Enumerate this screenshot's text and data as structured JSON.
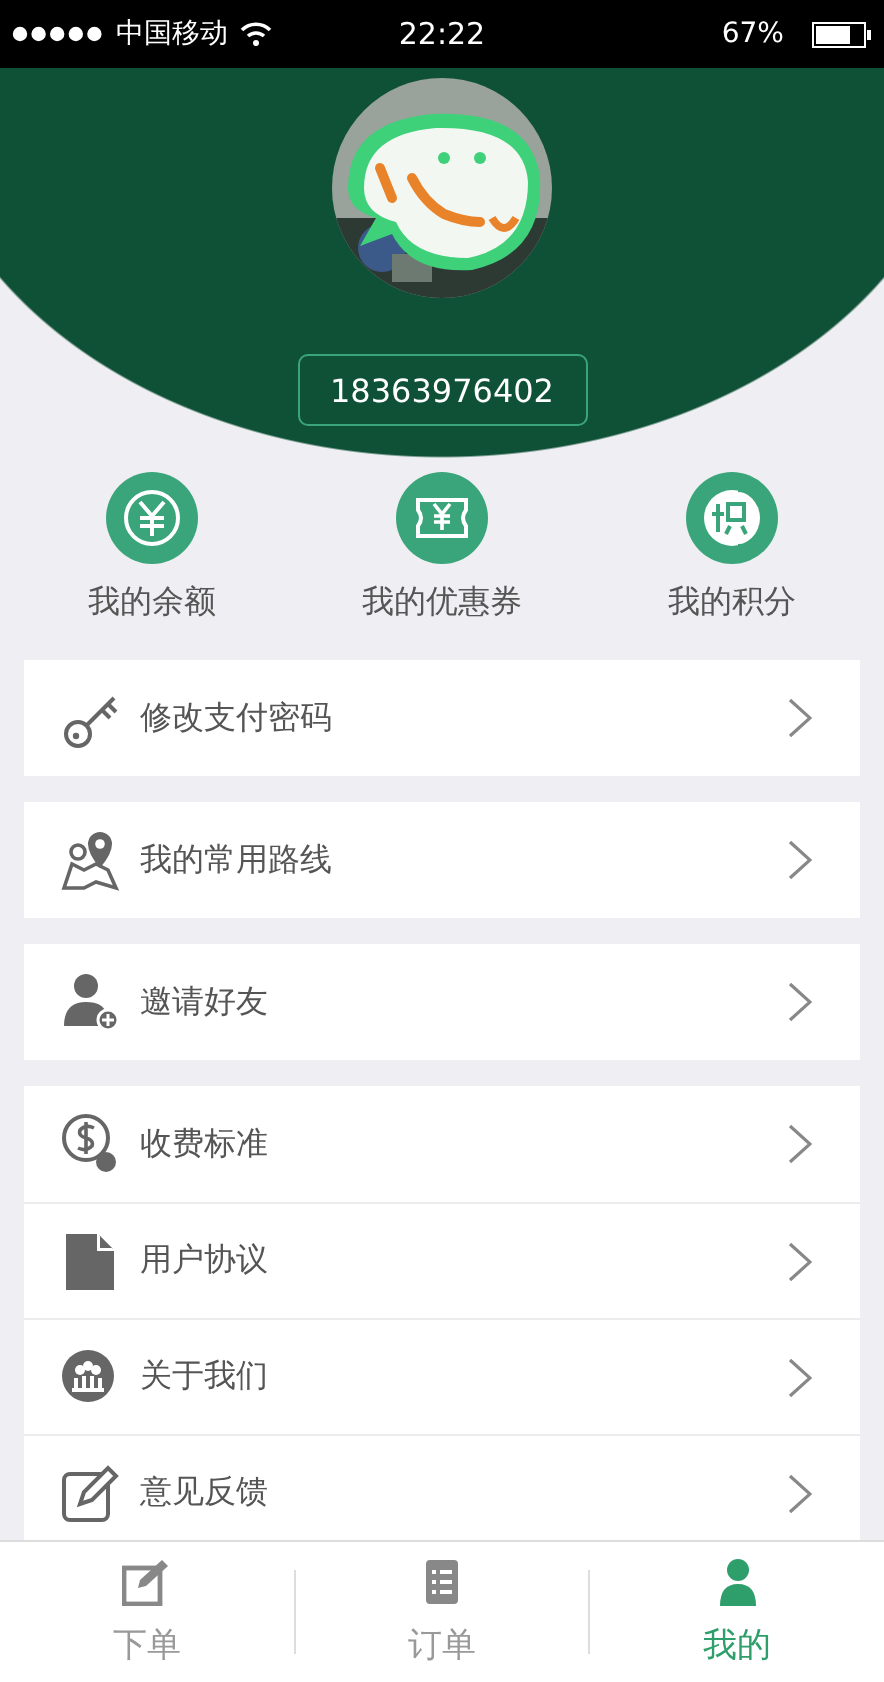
{
  "status_bar": {
    "carrier": "中国移动",
    "time": "22:22",
    "battery": "67%"
  },
  "profile": {
    "phone": "18363976402"
  },
  "quick_links": [
    {
      "label": "我的余额"
    },
    {
      "label": "我的优惠券"
    },
    {
      "label": "我的积分"
    }
  ],
  "menu_groups": [
    [
      {
        "label": "修改支付密码"
      }
    ],
    [
      {
        "label": "我的常用路线"
      }
    ],
    [
      {
        "label": "邀请好友"
      }
    ],
    [
      {
        "label": "收费标准"
      },
      {
        "label": "用户协议"
      },
      {
        "label": "关于我们"
      },
      {
        "label": "意见反馈"
      }
    ]
  ],
  "tabs": [
    {
      "label": "下单",
      "selected": false
    },
    {
      "label": "订单",
      "selected": false
    },
    {
      "label": "我的",
      "selected": true
    }
  ]
}
